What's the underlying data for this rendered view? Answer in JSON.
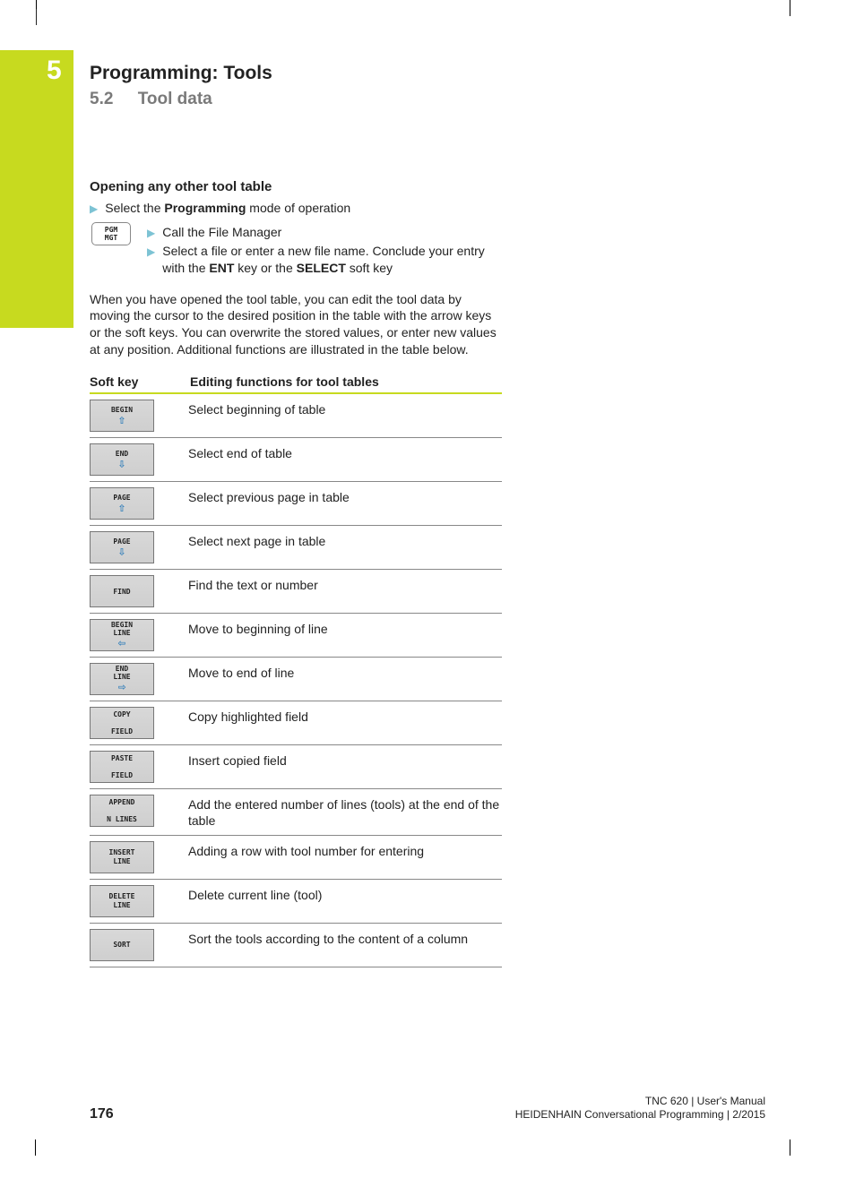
{
  "chapter": {
    "num": "5",
    "title": "Programming: Tools"
  },
  "section": {
    "num": "5.2",
    "title": "Tool data"
  },
  "sub": {
    "heading": "Opening any other tool table",
    "b1_pre": "Select the ",
    "b1_bold": "Programming",
    "b1_post": " mode of operation",
    "pgm_key_l1": "PGM",
    "pgm_key_l2": "MGT",
    "b2a": "Call the File Manager",
    "b2b_pre": "Select a file or enter a new file name. Conclude your entry with the ",
    "b2b_k1": "ENT",
    "b2b_mid": " key or the ",
    "b2b_k2": "SELECT",
    "b2b_post": " soft key",
    "para": "When you have opened the tool table, you can edit the tool data by moving the cursor to the desired position in the table with the arrow keys or the soft keys. You can overwrite the stored values, or enter new values at any position. Additional functions are illustrated in the table below."
  },
  "table": {
    "h1": "Soft key",
    "h2": "Editing functions for tool tables",
    "rows": [
      {
        "key": {
          "lines": [
            "BEGIN"
          ],
          "arrow": "up"
        },
        "desc": "Select beginning of table"
      },
      {
        "key": {
          "lines": [
            "END"
          ],
          "arrow": "down"
        },
        "desc": "Select end of table"
      },
      {
        "key": {
          "lines": [
            "PAGE"
          ],
          "arrow": "up"
        },
        "desc": "Select previous page in table"
      },
      {
        "key": {
          "lines": [
            "PAGE"
          ],
          "arrow": "down"
        },
        "desc": "Select next page in table"
      },
      {
        "key": {
          "lines": [
            "FIND"
          ],
          "arrow": null
        },
        "desc": "Find the text or number"
      },
      {
        "key": {
          "lines": [
            "BEGIN",
            "LINE"
          ],
          "arrow": "left"
        },
        "desc": "Move to beginning of line"
      },
      {
        "key": {
          "lines": [
            "END",
            "LINE"
          ],
          "arrow": "right"
        },
        "desc": "Move to end of line"
      },
      {
        "key": {
          "lines": [
            "COPY",
            "",
            "FIELD"
          ],
          "arrow": null
        },
        "desc": "Copy highlighted field"
      },
      {
        "key": {
          "lines": [
            "PASTE",
            "",
            "FIELD"
          ],
          "arrow": null
        },
        "desc": "Insert copied field"
      },
      {
        "key": {
          "lines": [
            "APPEND",
            "",
            "N LINES"
          ],
          "arrow": null
        },
        "desc": "Add the entered number of lines (tools) at the end of the table"
      },
      {
        "key": {
          "lines": [
            "INSERT",
            "LINE"
          ],
          "arrow": null
        },
        "desc": "Adding a row with tool number for entering"
      },
      {
        "key": {
          "lines": [
            "DELETE",
            "LINE"
          ],
          "arrow": null
        },
        "desc": "Delete current line (tool)"
      },
      {
        "key": {
          "lines": [
            "SORT"
          ],
          "arrow": null
        },
        "desc": "Sort the tools according to the content of a column"
      }
    ]
  },
  "footer": {
    "page": "176",
    "r1": "TNC 620 | User's Manual",
    "r2": "HEIDENHAIN Conversational Programming | 2/2015"
  }
}
